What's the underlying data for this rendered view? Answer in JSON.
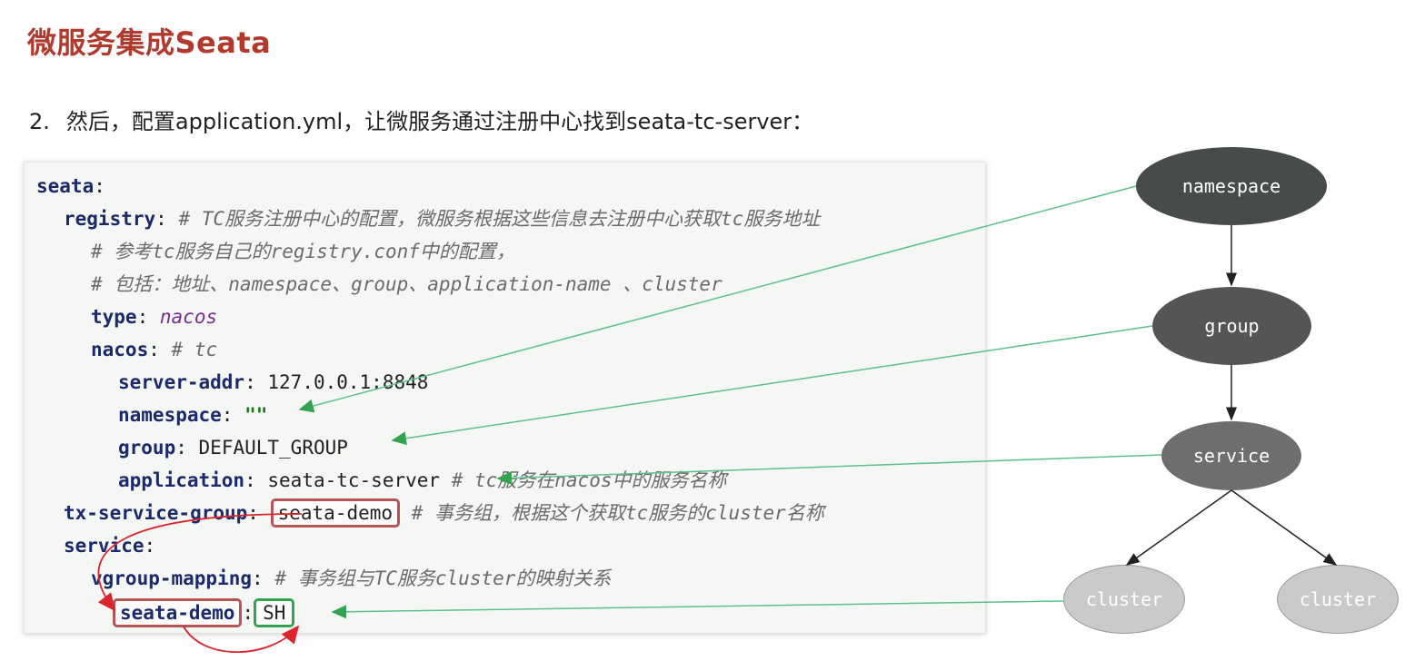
{
  "title": "微服务集成Seata",
  "step": {
    "number": "2.",
    "text": "然后，配置application.yml，让微服务通过注册中心找到seata-tc-server："
  },
  "code": {
    "l1": {
      "key": "seata",
      "colon": ":"
    },
    "l2": {
      "key": "registry",
      "colon": ":",
      "comment": "# TC服务注册中心的配置，微服务根据这些信息去注册中心获取tc服务地址"
    },
    "l3": {
      "comment": "# 参考tc服务自己的registry.conf中的配置，"
    },
    "l4": {
      "comment": "# 包括：地址、namespace、group、application-name 、cluster"
    },
    "l5": {
      "key": "type",
      "colon": ":",
      "value": "nacos"
    },
    "l6": {
      "key": "nacos",
      "colon": ":",
      "comment": "# tc"
    },
    "l7": {
      "key": "server-addr",
      "colon": ":",
      "value": "127.0.0.1:8848"
    },
    "l8": {
      "key": "namespace",
      "colon": ":",
      "value": "\"\""
    },
    "l9": {
      "key": "group",
      "colon": ":",
      "value": "DEFAULT_GROUP"
    },
    "l10": {
      "key": "application",
      "colon": ":",
      "value": "seata-tc-server",
      "comment": "# tc服务在nacos中的服务名称"
    },
    "l11": {
      "key": "tx-service-group",
      "colon": ":",
      "value": "seata-demo",
      "comment": "# 事务组，根据这个获取tc服务的cluster名称"
    },
    "l12": {
      "key": "service",
      "colon": ":"
    },
    "l13": {
      "key": "vgroup-mapping",
      "colon": ":",
      "comment": "# 事务组与TC服务cluster的映射关系"
    },
    "l14": {
      "key": "seata-demo",
      "colon": ":",
      "value": "SH"
    }
  },
  "tree": {
    "namespace": "namespace",
    "group": "group",
    "service": "service",
    "cluster_left": "cluster",
    "cluster_right": "cluster"
  },
  "colors": {
    "title": "#b03a2e",
    "highlight_red": "#b5545a",
    "highlight_green": "#33a351",
    "arrow_green": "#5cc08a",
    "arrow_red": "#d9252e",
    "node_namespace": "#474b4b",
    "node_group": "#555555",
    "node_service": "#6e6e6e",
    "node_cluster": "#cacaca"
  }
}
